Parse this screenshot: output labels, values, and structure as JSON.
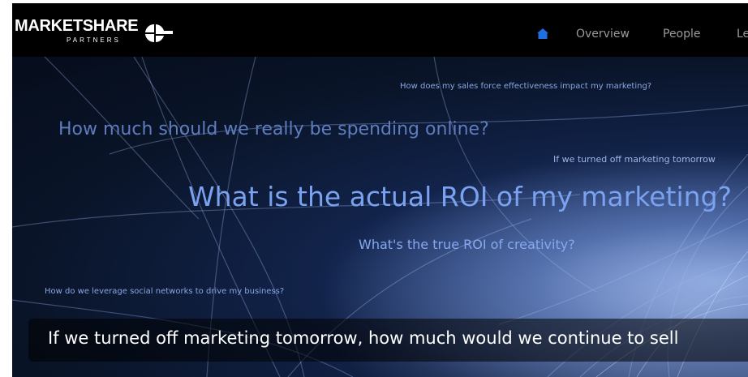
{
  "brand": {
    "name": "MARKETSHARE",
    "subtitle": "PARTNERS",
    "logo_icon": "split-circle-logo-icon"
  },
  "nav": {
    "home_icon": "home-icon",
    "home_color": "#1f6fe0",
    "items": [
      {
        "label": "Overview"
      },
      {
        "label": "People"
      },
      {
        "label": "Le"
      }
    ]
  },
  "hero": {
    "questions": [
      "How does my sales force effectiveness impact my marketing?",
      "How much should we really be spending online?",
      "If we turned off marketing tomorrow",
      "What is the actual ROI of my marketing?",
      "What's the true ROI of creativity?",
      "How do we leverage social networks to drive my business?"
    ],
    "banner_text": "If we turned off marketing tomorrow, how much would we continue to sell"
  }
}
